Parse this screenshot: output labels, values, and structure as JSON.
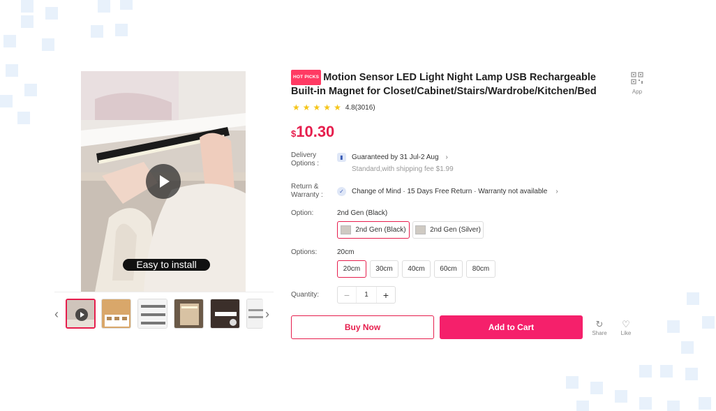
{
  "product": {
    "badge": "HOT PICKS",
    "title": "Motion Sensor LED Light Night Lamp USB Rechargeable Built-in Magnet for Closet/Cabinet/Stairs/Wardrobe/Kitchen/Bed",
    "app_label": "App",
    "rating_text": "4.8(3016)",
    "rating": 4.8,
    "currency": "$",
    "price": "10.30"
  },
  "media": {
    "caption": "Easy to install",
    "thumb_count": 6
  },
  "delivery": {
    "label_1": "Delivery",
    "label_2": "Options :",
    "value": "Guaranteed by 31 Jul-2 Aug",
    "sub": "Standard,with shipping fee $1.99"
  },
  "return": {
    "label_1": "Return &",
    "label_2": "Warranty :",
    "value": "Change of Mind · 15 Days Free Return · Warranty not available"
  },
  "option": {
    "label": "Option:",
    "selected": "2nd Gen (Black)",
    "choices": [
      "2nd Gen (Black)",
      "2nd Gen (Silver)"
    ]
  },
  "options": {
    "label": "Options:",
    "selected": "20cm",
    "choices": [
      "20cm",
      "30cm",
      "40cm",
      "60cm",
      "80cm"
    ]
  },
  "quantity": {
    "label": "Quantity:",
    "value": "1",
    "minus": "−",
    "plus": "+"
  },
  "actions": {
    "buy_now": "Buy Now",
    "add_to_cart": "Add to Cart",
    "share": "Share",
    "like": "Like"
  },
  "colors": {
    "accent": "#e61e4d",
    "cart": "#f5206b",
    "star": "#f5c518"
  }
}
